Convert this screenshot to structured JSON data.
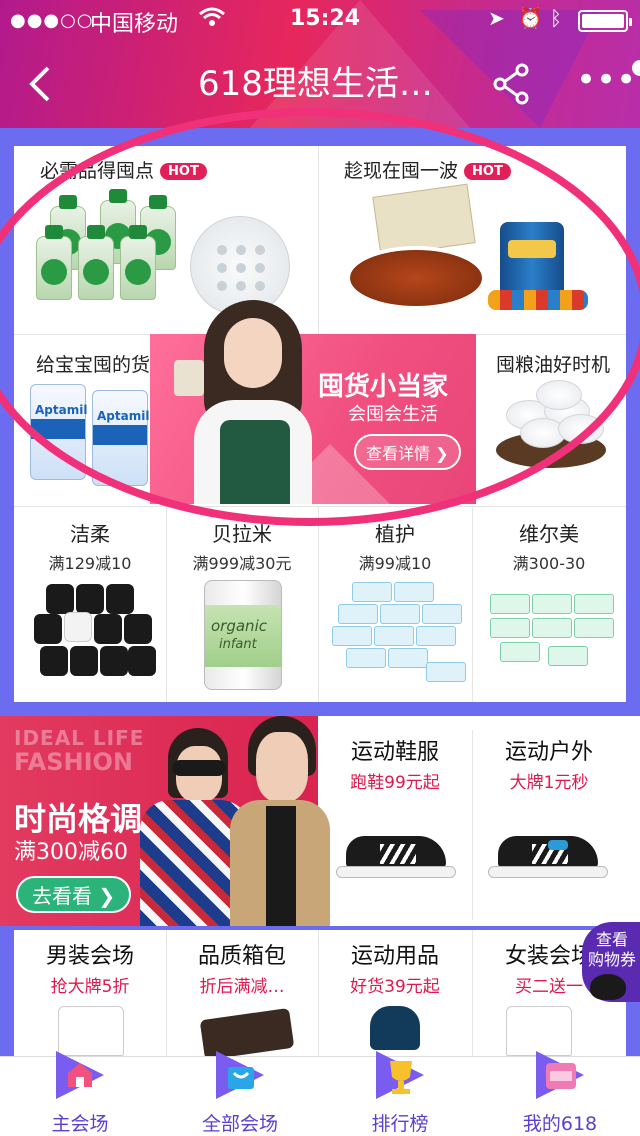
{
  "status_bar": {
    "signal": "●●●○○",
    "carrier": "中国移动",
    "time": "15:24"
  },
  "nav": {
    "title": "618理想生活…",
    "more": "•••"
  },
  "panel1": {
    "cells": [
      {
        "title": "必需品得囤点",
        "badge": "HOT"
      },
      {
        "title": "趁现在囤一波",
        "badge": "HOT"
      },
      {
        "title": "给宝宝囤的货"
      },
      {
        "title": "囤粮油好时机"
      }
    ],
    "promo": {
      "title": "囤货小当家",
      "subtitle": "会囤会生活",
      "button": "查看详情"
    },
    "brands": [
      {
        "name": "洁柔",
        "offer": "满129减10"
      },
      {
        "name": "贝拉米",
        "offer": "满999减30元"
      },
      {
        "name": "植护",
        "offer": "满99减10"
      },
      {
        "name": "维尔美",
        "offer": "满300-30"
      }
    ],
    "product_text": {
      "aptamil": "Aptamil",
      "organic": "organic",
      "infant": "infant"
    }
  },
  "fashion": {
    "ideal_life": "IDEAL LIFE",
    "fashion_word": "FASHION",
    "title": "时尚格调",
    "subtitle": "满300减60",
    "button": "去看看"
  },
  "sports": [
    {
      "title": "运动鞋服",
      "sub": "跑鞋99元起"
    },
    {
      "title": "运动户外",
      "sub": "大牌1元秒"
    }
  ],
  "categories": [
    {
      "title": "男装会场",
      "sub": "抢大牌5折"
    },
    {
      "title": "品质箱包",
      "sub": "折后满减…"
    },
    {
      "title": "运动用品",
      "sub": "好货39元起"
    },
    {
      "title": "女装会场",
      "sub": "买二送一"
    }
  ],
  "coupon": {
    "line1": "查看",
    "line2": "购物券"
  },
  "tabs": [
    {
      "label": "主会场"
    },
    {
      "label": "全部会场"
    },
    {
      "label": "排行榜"
    },
    {
      "label": "我的618"
    }
  ],
  "colors": {
    "accent": "#e1205a",
    "tab_text": "#5b3fd1",
    "page_bg": "#6b6cf0"
  }
}
